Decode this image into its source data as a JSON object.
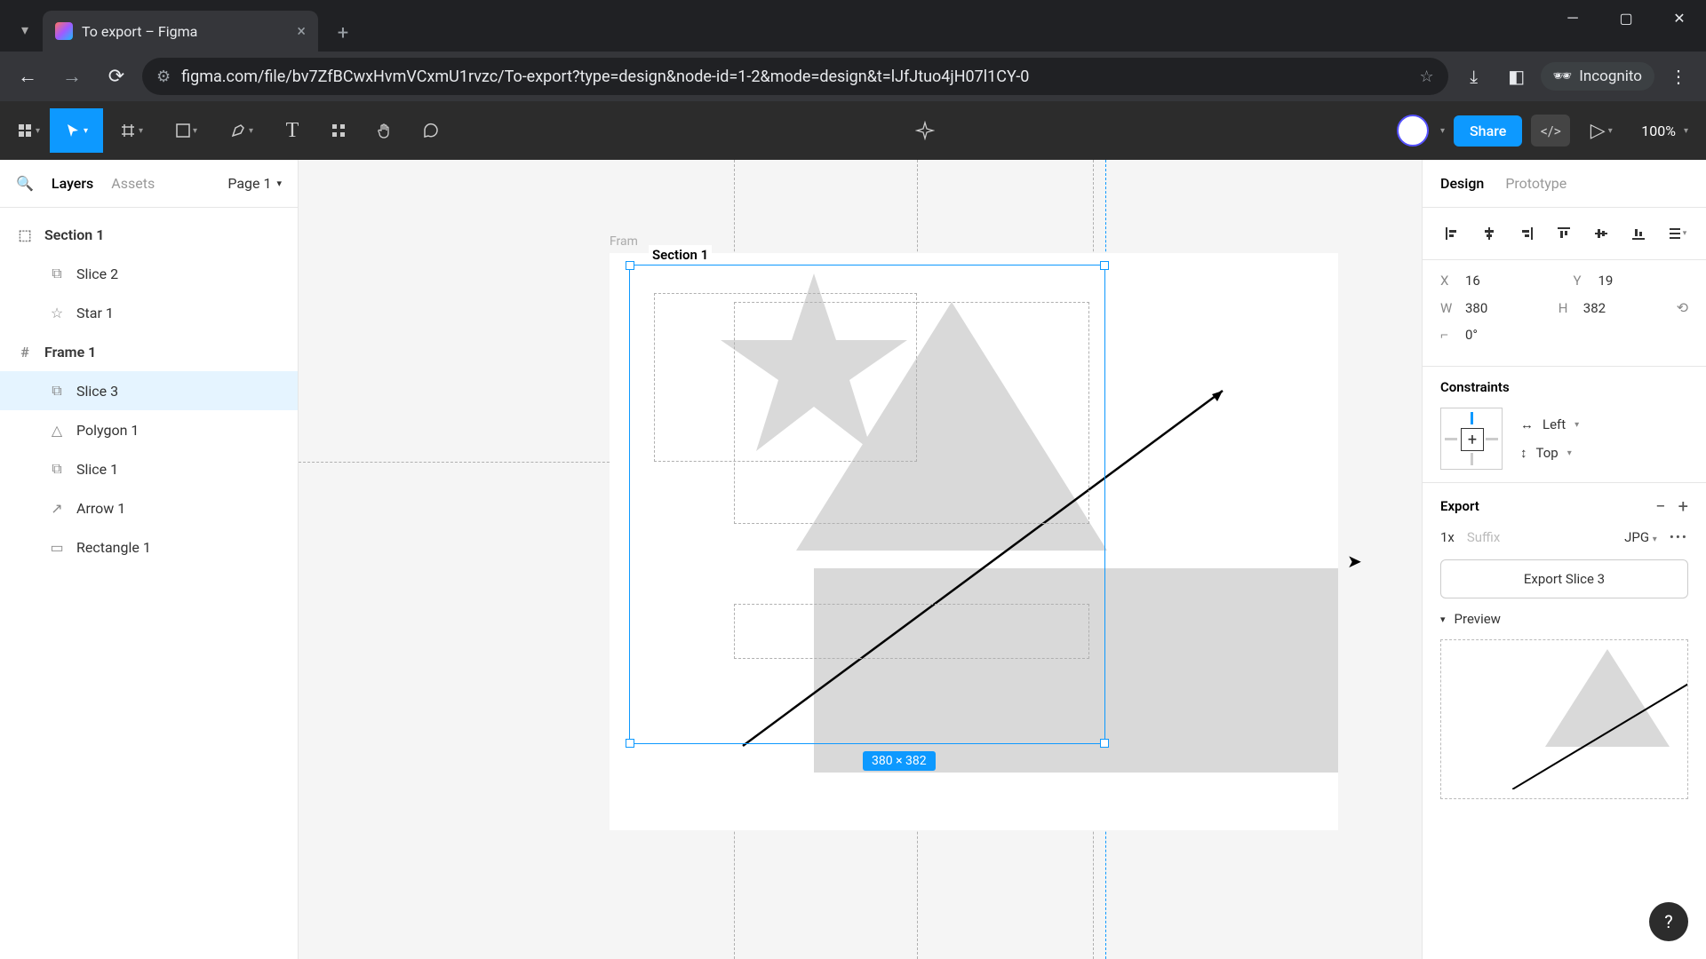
{
  "browser": {
    "tab_title": "To export – Figma",
    "url": "figma.com/file/bv7ZfBCwxHvmVCxmU1rvzc/To-export?type=design&node-id=1-2&mode=design&t=lJfJtuo4jH07l1CY-0",
    "incognito_label": "Incognito"
  },
  "toolbar": {
    "share_label": "Share",
    "zoom": "100%"
  },
  "left_panel": {
    "layers_tab": "Layers",
    "assets_tab": "Assets",
    "page_label": "Page 1",
    "layers": {
      "section1": "Section 1",
      "slice2": "Slice 2",
      "star1": "Star 1",
      "frame1": "Frame 1",
      "slice3": "Slice 3",
      "polygon1": "Polygon 1",
      "slice1": "Slice 1",
      "arrow1": "Arrow 1",
      "rectangle1": "Rectangle 1"
    }
  },
  "canvas": {
    "frame_label": "Fram",
    "section_label": "Section 1",
    "dimensions": "380 × 382"
  },
  "right_panel": {
    "design_tab": "Design",
    "prototype_tab": "Prototype",
    "x_label": "X",
    "x_val": "16",
    "y_label": "Y",
    "y_val": "19",
    "w_label": "W",
    "w_val": "380",
    "h_label": "H",
    "h_val": "382",
    "rot_val": "0°",
    "constraints_title": "Constraints",
    "constraint_h": "Left",
    "constraint_v": "Top",
    "export_title": "Export",
    "export_scale": "1x",
    "export_suffix_placeholder": "Suffix",
    "export_format": "JPG",
    "export_button": "Export Slice 3",
    "preview_label": "Preview"
  }
}
